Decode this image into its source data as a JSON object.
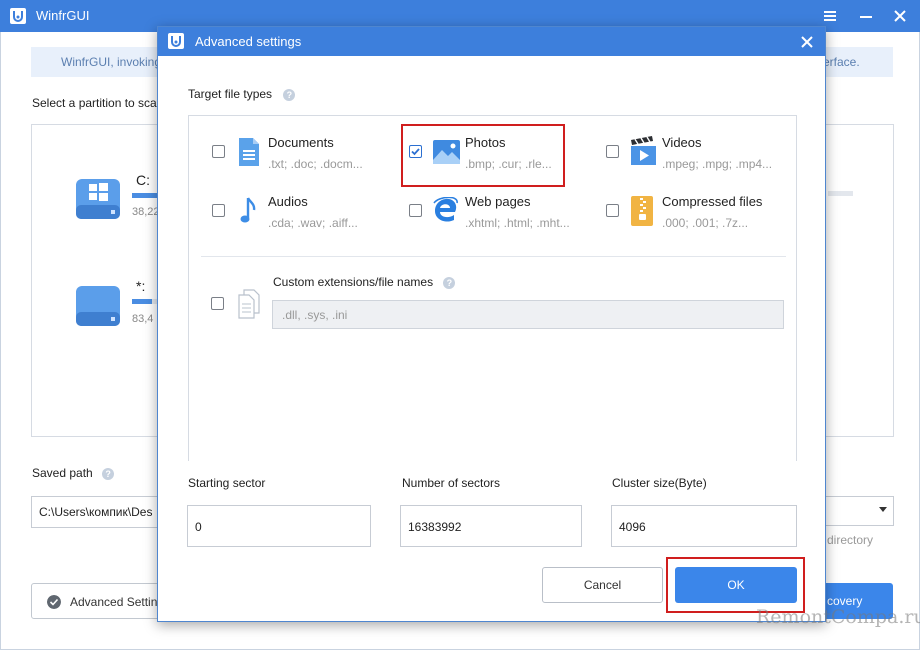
{
  "app": {
    "title": "WinfrGUI"
  },
  "banner": {
    "left_text": "WinfrGUI, invoking",
    "right_text": "erface."
  },
  "main": {
    "select_partition_label": "Select a partition to sca",
    "partitions": [
      {
        "name": "C:",
        "size": "38,22",
        "used_fraction": 0.78,
        "icon": "windows-drive-icon"
      },
      {
        "name": "*:",
        "size": "83,4",
        "used_fraction": 0.5,
        "icon": "drive-icon"
      }
    ],
    "saved_path_label": "Saved path",
    "saved_path_value": "C:\\Users\\компик\\Des",
    "dir_hint": "directory",
    "advanced_button": "Advanced Settin",
    "recovery_button": "covery"
  },
  "dialog": {
    "title": "Advanced settings",
    "target_types_label": "Target file types",
    "file_types": [
      {
        "name": "Documents",
        "ext": ".txt; .doc; .docm...",
        "checked": false,
        "icon": "document-icon"
      },
      {
        "name": "Photos",
        "ext": ".bmp; .cur; .rle...",
        "checked": true,
        "icon": "photo-icon"
      },
      {
        "name": "Videos",
        "ext": ".mpeg; .mpg; .mp4...",
        "checked": false,
        "icon": "video-icon"
      },
      {
        "name": "Audios",
        "ext": ".cda; .wav; .aiff...",
        "checked": false,
        "icon": "music-note-icon"
      },
      {
        "name": "Web pages",
        "ext": ".xhtml; .html; .mht...",
        "checked": false,
        "icon": "web-browser-icon"
      },
      {
        "name": "Compressed files",
        "ext": ".000; .001; .7z...",
        "checked": false,
        "icon": "archive-icon"
      }
    ],
    "custom_label": "Custom extensions/file names",
    "custom_placeholder": ".dll, .sys, .ini",
    "starting_sector_label": "Starting sector",
    "starting_sector_value": "0",
    "number_of_sectors_label": "Number of sectors",
    "number_of_sectors_value": "16383992",
    "cluster_size_label": "Cluster size(Byte)",
    "cluster_size_value": "4096",
    "cancel_label": "Cancel",
    "ok_label": "OK"
  },
  "watermark": "RemontCompa.ru",
  "colors": {
    "accent": "#3d7fdc",
    "button_blue": "#3b86ea",
    "highlight_red": "#d01e1e"
  }
}
